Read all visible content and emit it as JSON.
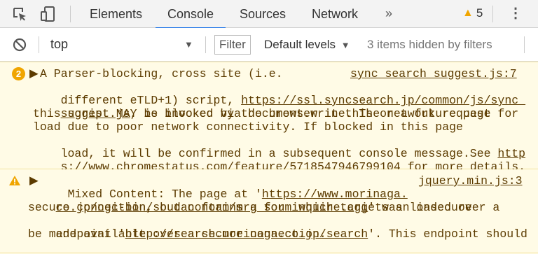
{
  "tabs": [
    {
      "label": "Elements"
    },
    {
      "label": "Console"
    },
    {
      "label": "Sources"
    },
    {
      "label": "Network"
    }
  ],
  "more_tabs": "»",
  "warning_count": "5",
  "toolbar": {
    "context": "top",
    "filter_label": "Filter",
    "levels_label": "Default levels",
    "hidden_note": "3 items hidden by filters"
  },
  "messages": [
    {
      "count": "2",
      "source": "sync_search_suggest.js:7",
      "lines": [
        "A Parser-blocking, cross site (i.e.",
        "different eTLD+1) script, ",
        "https://ssl.syncsearch.jp/common/js/sync_",
        "suggest.js",
        ", is invoked via document.write. The network request for",
        "this script MAY be blocked by the browser in this or a future page",
        "load due to poor network connectivity. If blocked in this page",
        "load, it will be confirmed in a subsequent console message.See ",
        "http",
        "s://www.chromestatus.com/feature/5718547946799104",
        " for more details."
      ]
    },
    {
      "source": "jquery.min.js:3",
      "lines": [
        "Mixed Content: The page at '",
        "https://www.morinaga.",
        "co.jp/cgi-bin/soudan_form/mrg_sou_inquire.cgi",
        "' was loaded over a",
        "secure connection, but contains a form which targets an insecure",
        "endpoint '",
        "http://search.morinaga.co.jp/search",
        "'. This endpoint should",
        "be made available over a secure connection."
      ]
    }
  ]
}
